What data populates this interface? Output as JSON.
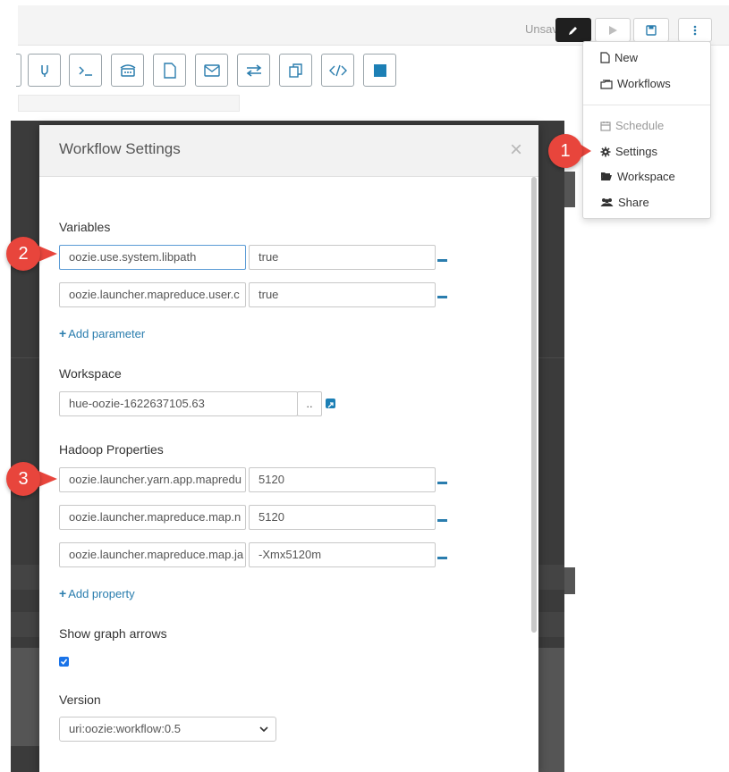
{
  "header": {
    "status": "Unsaved"
  },
  "palette": {
    "icons": [
      "fork-icon",
      "shell-icon",
      "ssh-icon",
      "file-icon",
      "email-icon",
      "distcp-icon",
      "copy-icon",
      "code-icon",
      "stop-icon"
    ]
  },
  "menu": {
    "items": [
      {
        "label": "New",
        "icon": "file-icon",
        "disabled": false
      },
      {
        "label": "Workflows",
        "icon": "workflows-icon",
        "disabled": false
      },
      {
        "label": "Schedule",
        "icon": "calendar-icon",
        "disabled": true
      },
      {
        "label": "Settings",
        "icon": "gear-icon",
        "disabled": false
      },
      {
        "label": "Workspace",
        "icon": "folder-open-icon",
        "disabled": false
      },
      {
        "label": "Share",
        "icon": "users-icon",
        "disabled": false
      }
    ]
  },
  "modal": {
    "title": "Workflow Settings",
    "close": "×",
    "variables_label": "Variables",
    "variables": [
      {
        "name": "oozie.use.system.libpath",
        "value": "true"
      },
      {
        "name": "oozie.launcher.mapreduce.user.c",
        "value": "true"
      }
    ],
    "add_parameter": "Add parameter",
    "workspace_label": "Workspace",
    "workspace_value": "hue-oozie-1622637105.63",
    "workspace_browse": "..",
    "hadoop_label": "Hadoop Properties",
    "properties": [
      {
        "name": "oozie.launcher.yarn.app.mapredu",
        "value": "5120"
      },
      {
        "name": "oozie.launcher.mapreduce.map.n",
        "value": "5120"
      },
      {
        "name": "oozie.launcher.mapreduce.map.ja",
        "value": "-Xmx5120m"
      }
    ],
    "add_property": "Add property",
    "arrows_label": "Show graph arrows",
    "arrows_checked": true,
    "version_label": "Version",
    "version_value": "uri:oozie:workflow:0.5"
  },
  "callouts": [
    "1",
    "2",
    "3"
  ],
  "colors": {
    "accent": "#2a7dae",
    "callout": "#e8453c",
    "checkbox": "#1a73e8"
  }
}
